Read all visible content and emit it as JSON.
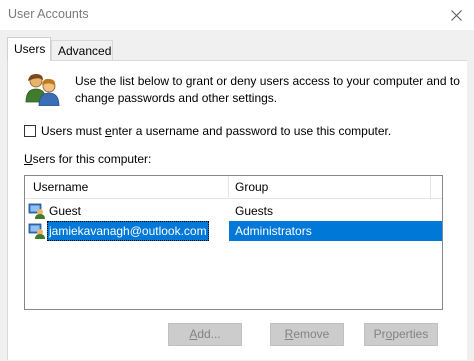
{
  "window": {
    "title": "User Accounts"
  },
  "tabs": [
    {
      "label": "Users",
      "selected": true
    },
    {
      "label": "Advanced",
      "selected": false
    }
  ],
  "intro_text": "Use the list below to grant or deny users access to your computer and to change passwords and other settings.",
  "require_login": {
    "label_before": "Users must ",
    "label_accel": "e",
    "label_after": "nter a username and password to use this computer.",
    "checked": false
  },
  "user_list": {
    "label_accel": "U",
    "label_rest": "sers for this computer:",
    "columns": [
      "Username",
      "Group"
    ],
    "rows": [
      {
        "username": "Guest",
        "group": "Guests",
        "icon": "user-account-icon",
        "selected": false
      },
      {
        "username": "jamiekavanagh@outlook.com",
        "group": "Administrators",
        "icon": "user-account-icon",
        "selected": true
      }
    ]
  },
  "buttons": {
    "add": {
      "accel": "A",
      "rest": "dd...",
      "enabled": false
    },
    "remove": {
      "accel": "R",
      "rest": "emove",
      "enabled": false
    },
    "properties": {
      "before": "Pr",
      "accel": "o",
      "after": "perties",
      "enabled": false
    }
  },
  "colors": {
    "selection": "#0078d7",
    "dialog_bg": "#f0f0f0",
    "disabled_button": "#cccccc"
  }
}
